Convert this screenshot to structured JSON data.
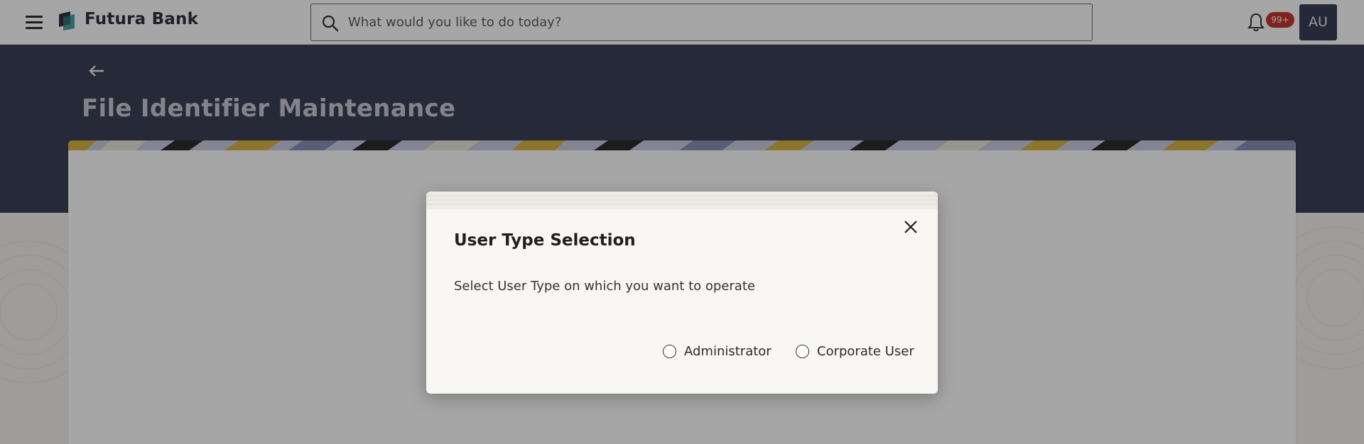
{
  "header": {
    "brand": "Futura Bank",
    "search_placeholder": "What would you like to do today?",
    "notification_badge": "99+",
    "avatar_initials": "AU"
  },
  "page": {
    "title": "File Identifier Maintenance"
  },
  "modal": {
    "title": "User Type Selection",
    "message": "Select User Type on which you want to operate",
    "options": [
      {
        "label": "Administrator",
        "selected": false
      },
      {
        "label": "Corporate User",
        "selected": false
      }
    ]
  },
  "colors": {
    "brand_navy": "#3b3f55",
    "badge_red": "#c0392b",
    "stripe_gold": "#d9b445"
  },
  "icons": [
    "menu-icon",
    "bank-logo-icon",
    "search-icon",
    "bell-icon",
    "back-arrow-icon",
    "close-icon"
  ]
}
